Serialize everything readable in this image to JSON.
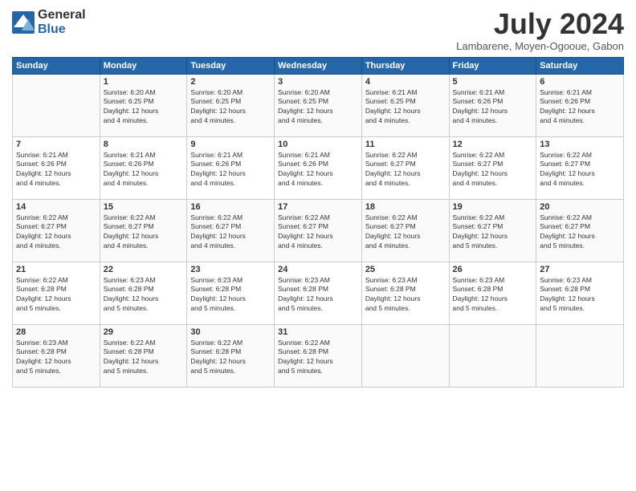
{
  "logo": {
    "general": "General",
    "blue": "Blue"
  },
  "title": "July 2024",
  "location": "Lambarene, Moyen-Ogooue, Gabon",
  "days_of_week": [
    "Sunday",
    "Monday",
    "Tuesday",
    "Wednesday",
    "Thursday",
    "Friday",
    "Saturday"
  ],
  "weeks": [
    [
      {
        "day": "",
        "info": ""
      },
      {
        "day": "1",
        "info": "Sunrise: 6:20 AM\nSunset: 6:25 PM\nDaylight: 12 hours\nand 4 minutes."
      },
      {
        "day": "2",
        "info": "Sunrise: 6:20 AM\nSunset: 6:25 PM\nDaylight: 12 hours\nand 4 minutes."
      },
      {
        "day": "3",
        "info": "Sunrise: 6:20 AM\nSunset: 6:25 PM\nDaylight: 12 hours\nand 4 minutes."
      },
      {
        "day": "4",
        "info": "Sunrise: 6:21 AM\nSunset: 6:25 PM\nDaylight: 12 hours\nand 4 minutes."
      },
      {
        "day": "5",
        "info": "Sunrise: 6:21 AM\nSunset: 6:26 PM\nDaylight: 12 hours\nand 4 minutes."
      },
      {
        "day": "6",
        "info": "Sunrise: 6:21 AM\nSunset: 6:26 PM\nDaylight: 12 hours\nand 4 minutes."
      }
    ],
    [
      {
        "day": "7",
        "info": "Sunrise: 6:21 AM\nSunset: 6:26 PM\nDaylight: 12 hours\nand 4 minutes."
      },
      {
        "day": "8",
        "info": "Sunrise: 6:21 AM\nSunset: 6:26 PM\nDaylight: 12 hours\nand 4 minutes."
      },
      {
        "day": "9",
        "info": "Sunrise: 6:21 AM\nSunset: 6:26 PM\nDaylight: 12 hours\nand 4 minutes."
      },
      {
        "day": "10",
        "info": "Sunrise: 6:21 AM\nSunset: 6:26 PM\nDaylight: 12 hours\nand 4 minutes."
      },
      {
        "day": "11",
        "info": "Sunrise: 6:22 AM\nSunset: 6:27 PM\nDaylight: 12 hours\nand 4 minutes."
      },
      {
        "day": "12",
        "info": "Sunrise: 6:22 AM\nSunset: 6:27 PM\nDaylight: 12 hours\nand 4 minutes."
      },
      {
        "day": "13",
        "info": "Sunrise: 6:22 AM\nSunset: 6:27 PM\nDaylight: 12 hours\nand 4 minutes."
      }
    ],
    [
      {
        "day": "14",
        "info": "Sunrise: 6:22 AM\nSunset: 6:27 PM\nDaylight: 12 hours\nand 4 minutes."
      },
      {
        "day": "15",
        "info": "Sunrise: 6:22 AM\nSunset: 6:27 PM\nDaylight: 12 hours\nand 4 minutes."
      },
      {
        "day": "16",
        "info": "Sunrise: 6:22 AM\nSunset: 6:27 PM\nDaylight: 12 hours\nand 4 minutes."
      },
      {
        "day": "17",
        "info": "Sunrise: 6:22 AM\nSunset: 6:27 PM\nDaylight: 12 hours\nand 4 minutes."
      },
      {
        "day": "18",
        "info": "Sunrise: 6:22 AM\nSunset: 6:27 PM\nDaylight: 12 hours\nand 4 minutes."
      },
      {
        "day": "19",
        "info": "Sunrise: 6:22 AM\nSunset: 6:27 PM\nDaylight: 12 hours\nand 5 minutes."
      },
      {
        "day": "20",
        "info": "Sunrise: 6:22 AM\nSunset: 6:27 PM\nDaylight: 12 hours\nand 5 minutes."
      }
    ],
    [
      {
        "day": "21",
        "info": "Sunrise: 6:22 AM\nSunset: 6:28 PM\nDaylight: 12 hours\nand 5 minutes."
      },
      {
        "day": "22",
        "info": "Sunrise: 6:23 AM\nSunset: 6:28 PM\nDaylight: 12 hours\nand 5 minutes."
      },
      {
        "day": "23",
        "info": "Sunrise: 6:23 AM\nSunset: 6:28 PM\nDaylight: 12 hours\nand 5 minutes."
      },
      {
        "day": "24",
        "info": "Sunrise: 6:23 AM\nSunset: 6:28 PM\nDaylight: 12 hours\nand 5 minutes."
      },
      {
        "day": "25",
        "info": "Sunrise: 6:23 AM\nSunset: 6:28 PM\nDaylight: 12 hours\nand 5 minutes."
      },
      {
        "day": "26",
        "info": "Sunrise: 6:23 AM\nSunset: 6:28 PM\nDaylight: 12 hours\nand 5 minutes."
      },
      {
        "day": "27",
        "info": "Sunrise: 6:23 AM\nSunset: 6:28 PM\nDaylight: 12 hours\nand 5 minutes."
      }
    ],
    [
      {
        "day": "28",
        "info": "Sunrise: 6:23 AM\nSunset: 6:28 PM\nDaylight: 12 hours\nand 5 minutes."
      },
      {
        "day": "29",
        "info": "Sunrise: 6:22 AM\nSunset: 6:28 PM\nDaylight: 12 hours\nand 5 minutes."
      },
      {
        "day": "30",
        "info": "Sunrise: 6:22 AM\nSunset: 6:28 PM\nDaylight: 12 hours\nand 5 minutes."
      },
      {
        "day": "31",
        "info": "Sunrise: 6:22 AM\nSunset: 6:28 PM\nDaylight: 12 hours\nand 5 minutes."
      },
      {
        "day": "",
        "info": ""
      },
      {
        "day": "",
        "info": ""
      },
      {
        "day": "",
        "info": ""
      }
    ]
  ]
}
